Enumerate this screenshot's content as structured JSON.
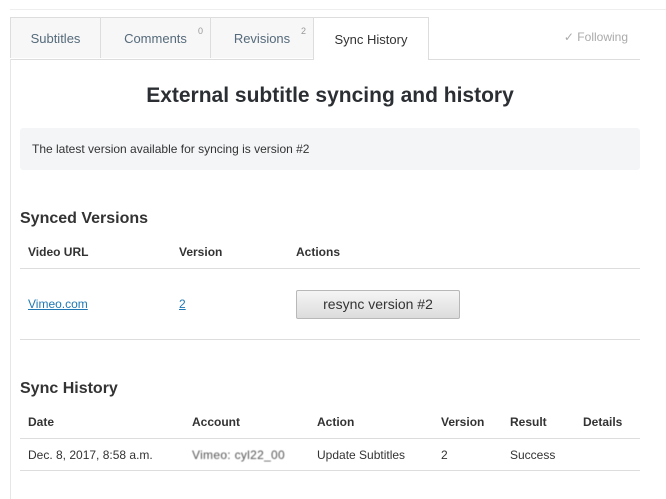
{
  "tabs": [
    {
      "label": "Subtitles",
      "count": ""
    },
    {
      "label": "Comments",
      "count": "0"
    },
    {
      "label": "Revisions",
      "count": "2"
    },
    {
      "label": "Sync History",
      "count": ""
    }
  ],
  "following": {
    "icon": "checkmark-icon",
    "label": "✓ Following"
  },
  "page_title": "External subtitle syncing and history",
  "info": "The latest version available for syncing is version #2",
  "synced_versions": {
    "title": "Synced Versions",
    "headers": [
      "Video URL",
      "Version",
      "Actions"
    ],
    "rows": [
      {
        "video_url": "Vimeo.com",
        "version": "2",
        "action_label": "resync version #2"
      }
    ]
  },
  "sync_history": {
    "title": "Sync History",
    "headers": [
      "Date",
      "Account",
      "Action",
      "Version",
      "Result",
      "Details"
    ],
    "rows": [
      {
        "date": "Dec. 8, 2017, 8:58 a.m.",
        "account": "Vimeo: cyl22_00",
        "action": "Update Subtitles",
        "version": "2",
        "result": "Success",
        "details": ""
      }
    ]
  }
}
